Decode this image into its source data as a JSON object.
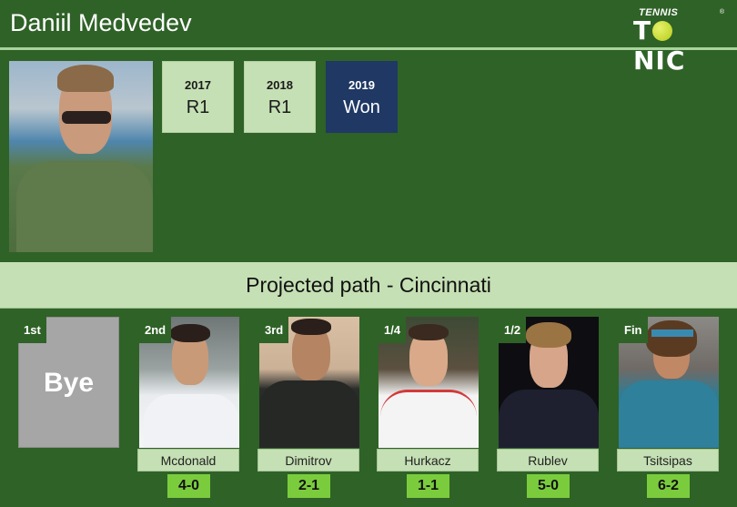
{
  "header": {
    "player_name": "Daniil Medvedev",
    "logo": {
      "top": "TENNIS",
      "main_left": "T",
      "main_right": "NIC",
      "icon": "tennis-ball-icon",
      "reg": "®"
    }
  },
  "history": [
    {
      "year": "2017",
      "result": "R1",
      "highlight": false
    },
    {
      "year": "2018",
      "result": "R1",
      "highlight": false
    },
    {
      "year": "2019",
      "result": "Won",
      "highlight": true
    }
  ],
  "colors": {
    "background": "#2f6227",
    "light_green": "#c5e0b4",
    "won_navy": "#1f3864",
    "score_green": "#7acc3d",
    "bye_gray": "#a6a6a6"
  },
  "path": {
    "title": "Projected path - Cincinnati",
    "rounds": [
      {
        "round": "1st",
        "opponent": "Bye",
        "h2h": null
      },
      {
        "round": "2nd",
        "opponent": "Mcdonald",
        "h2h": "4-0"
      },
      {
        "round": "3rd",
        "opponent": "Dimitrov",
        "h2h": "2-1"
      },
      {
        "round": "1/4",
        "opponent": "Hurkacz",
        "h2h": "1-1"
      },
      {
        "round": "1/2",
        "opponent": "Rublev",
        "h2h": "5-0"
      },
      {
        "round": "Fin",
        "opponent": "Tsitsipas",
        "h2h": "6-2"
      }
    ]
  }
}
